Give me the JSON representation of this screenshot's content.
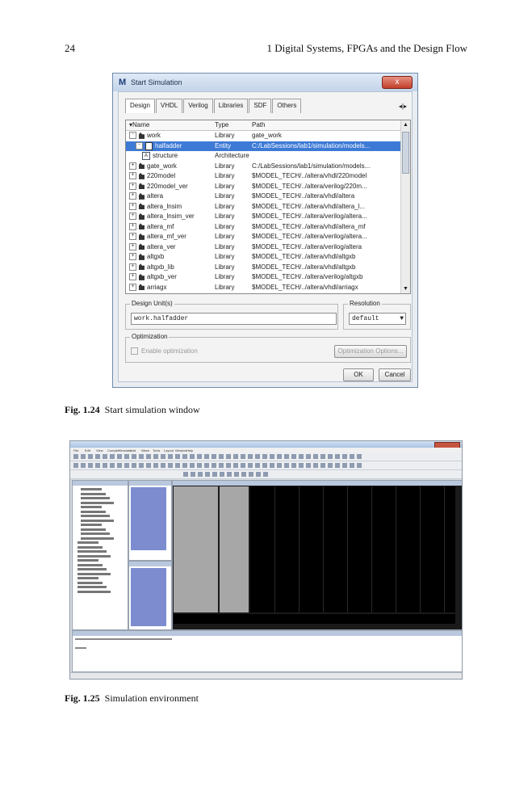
{
  "page": {
    "number": "24",
    "running_head": "1   Digital Systems, FPGAs and the Design Flow"
  },
  "figure_1_24": {
    "dialog_title": "Start Simulation",
    "close_label": "x",
    "tabs": [
      "Design",
      "VHDL",
      "Verilog",
      "Libraries",
      "SDF",
      "Others"
    ],
    "columns": {
      "name": "Name",
      "type": "Type",
      "path": "Path"
    },
    "rows": [
      {
        "name": "work",
        "type": "Library",
        "path": "gate_work",
        "kind": "library",
        "expander": "-",
        "indent": 0
      },
      {
        "name": "halfadder",
        "type": "Entity",
        "path": "C:/LabSessions/lab1/simulation/models...",
        "kind": "entity",
        "expander": "-",
        "indent": 1,
        "selected": true
      },
      {
        "name": "structure",
        "type": "Architecture",
        "path": "",
        "kind": "architecture",
        "expander": "",
        "indent": 2
      },
      {
        "name": "gate_work",
        "type": "Library",
        "path": "C:/LabSessions/lab1/simulation/models...",
        "kind": "library",
        "expander": "+",
        "indent": 0
      },
      {
        "name": "220model",
        "type": "Library",
        "path": "$MODEL_TECH/../altera/vhdl/220model",
        "kind": "library",
        "expander": "+",
        "indent": 0
      },
      {
        "name": "220model_ver",
        "type": "Library",
        "path": "$MODEL_TECH/../altera/verilog/220m...",
        "kind": "library",
        "expander": "+",
        "indent": 0
      },
      {
        "name": "altera",
        "type": "Library",
        "path": "$MODEL_TECH/../altera/vhdl/altera",
        "kind": "library",
        "expander": "+",
        "indent": 0
      },
      {
        "name": "altera_lnsim",
        "type": "Library",
        "path": "$MODEL_TECH/../altera/vhdl/altera_l...",
        "kind": "library",
        "expander": "+",
        "indent": 0
      },
      {
        "name": "altera_lnsim_ver",
        "type": "Library",
        "path": "$MODEL_TECH/../altera/verilog/altera...",
        "kind": "library",
        "expander": "+",
        "indent": 0
      },
      {
        "name": "altera_mf",
        "type": "Library",
        "path": "$MODEL_TECH/../altera/vhdl/altera_mf",
        "kind": "library",
        "expander": "+",
        "indent": 0
      },
      {
        "name": "altera_mf_ver",
        "type": "Library",
        "path": "$MODEL_TECH/../altera/verilog/altera...",
        "kind": "library",
        "expander": "+",
        "indent": 0
      },
      {
        "name": "altera_ver",
        "type": "Library",
        "path": "$MODEL_TECH/../altera/verilog/altera",
        "kind": "library",
        "expander": "+",
        "indent": 0
      },
      {
        "name": "altgxb",
        "type": "Library",
        "path": "$MODEL_TECH/../altera/vhdl/altgxb",
        "kind": "library",
        "expander": "+",
        "indent": 0
      },
      {
        "name": "altgxb_lib",
        "type": "Library",
        "path": "$MODEL_TECH/../altera/vhdl/altgxb",
        "kind": "library",
        "expander": "+",
        "indent": 0
      },
      {
        "name": "altgxb_ver",
        "type": "Library",
        "path": "$MODEL_TECH/../altera/verilog/altgxb",
        "kind": "library",
        "expander": "+",
        "indent": 0
      },
      {
        "name": "arriagx",
        "type": "Library",
        "path": "$MODEL_TECH/../altera/vhdl/arriagx",
        "kind": "library",
        "expander": "+",
        "indent": 0
      }
    ],
    "design_unit_label": "Design Unit(s)",
    "design_unit_value": "work.halfadder",
    "resolution_label": "Resolution",
    "resolution_value": "default",
    "optimization_label": "Optimization",
    "enable_optimization_label": "Enable optimization",
    "optimization_options_label": "Optimization Options...",
    "ok_label": "OK",
    "cancel_label": "Cancel",
    "caption_label": "Fig. 1.24",
    "caption_text": "Start simulation window"
  },
  "figure_1_25": {
    "menu_items": [
      "File",
      "Edit",
      "View",
      "Compile",
      "Simulate",
      "Add",
      "Wave",
      "Tools",
      "Layout",
      "Window",
      "Help"
    ],
    "caption_label": "Fig. 1.25",
    "caption_text": "Simulation environment"
  }
}
